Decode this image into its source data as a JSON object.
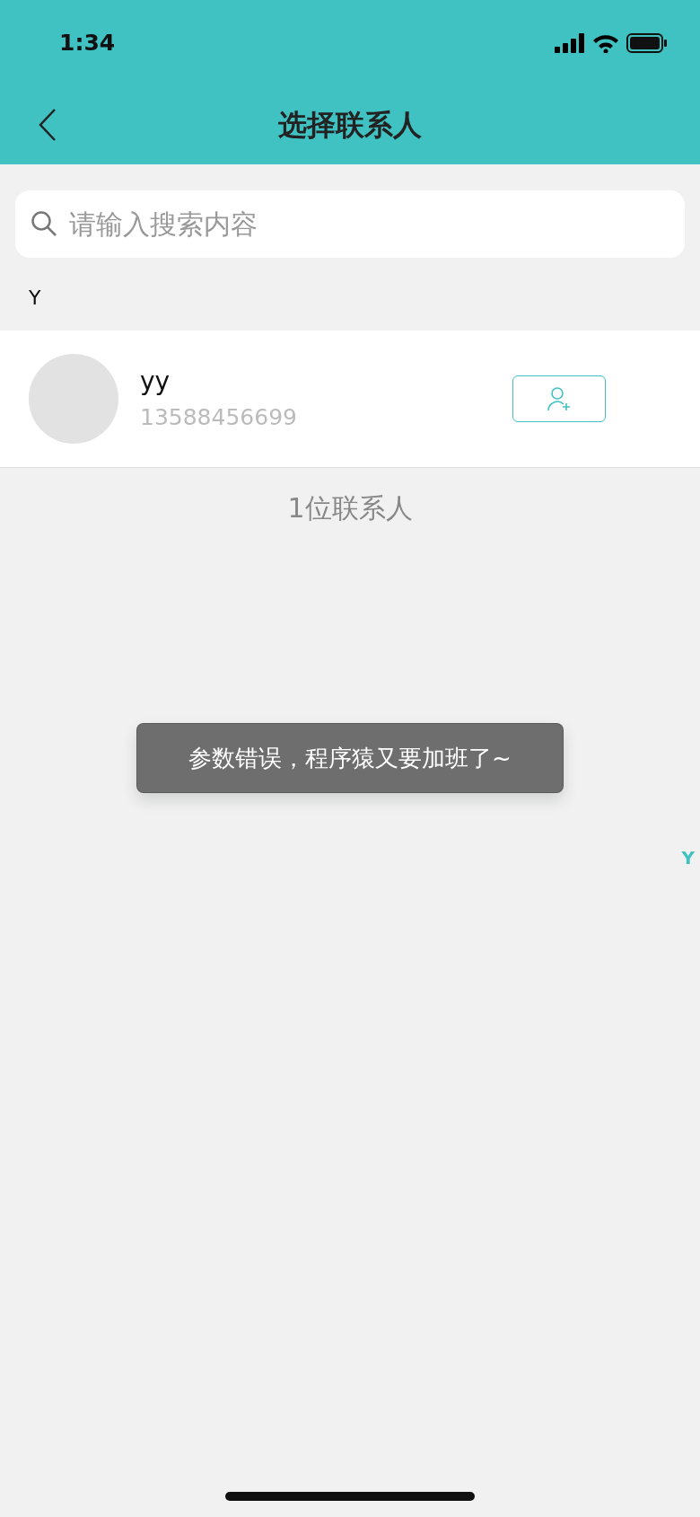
{
  "status_bar": {
    "time": "1:34"
  },
  "header": {
    "title": "选择联系人"
  },
  "search": {
    "placeholder": "请输入搜索内容"
  },
  "sections": [
    {
      "letter": "Y",
      "contacts": [
        {
          "name": "yy",
          "phone": "13588456699"
        }
      ]
    }
  ],
  "footer_count": "1位联系人",
  "toast": "参数错误，程序猿又要加班了~",
  "index_letters": [
    {
      "letter": "Y",
      "selected": true
    }
  ]
}
